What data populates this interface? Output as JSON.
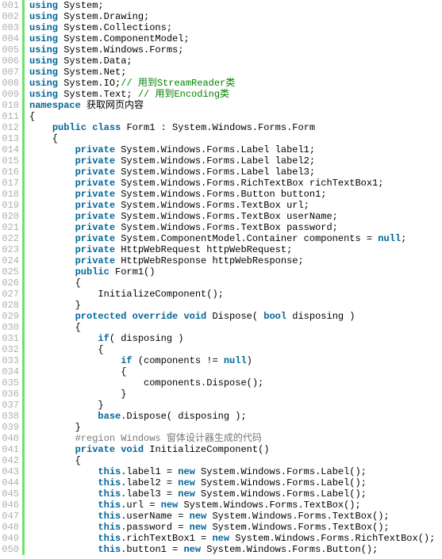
{
  "lines": [
    {
      "num": "001",
      "tokens": [
        {
          "c": "kw",
          "t": "using"
        },
        {
          "c": "pl",
          "t": " System;"
        }
      ]
    },
    {
      "num": "002",
      "tokens": [
        {
          "c": "kw",
          "t": "using"
        },
        {
          "c": "pl",
          "t": " System.Drawing;"
        }
      ]
    },
    {
      "num": "003",
      "tokens": [
        {
          "c": "kw",
          "t": "using"
        },
        {
          "c": "pl",
          "t": " System.Collections;"
        }
      ]
    },
    {
      "num": "004",
      "tokens": [
        {
          "c": "kw",
          "t": "using"
        },
        {
          "c": "pl",
          "t": " System.ComponentModel;"
        }
      ]
    },
    {
      "num": "005",
      "tokens": [
        {
          "c": "kw",
          "t": "using"
        },
        {
          "c": "pl",
          "t": " System.Windows.Forms;"
        }
      ]
    },
    {
      "num": "006",
      "tokens": [
        {
          "c": "kw",
          "t": "using"
        },
        {
          "c": "pl",
          "t": " System.Data;"
        }
      ]
    },
    {
      "num": "007",
      "tokens": [
        {
          "c": "kw",
          "t": "using"
        },
        {
          "c": "pl",
          "t": " System.Net;"
        }
      ]
    },
    {
      "num": "008",
      "tokens": [
        {
          "c": "kw",
          "t": "using"
        },
        {
          "c": "pl",
          "t": " System.IO;"
        },
        {
          "c": "cm",
          "t": "// 用到StreamReader类"
        }
      ]
    },
    {
      "num": "009",
      "tokens": [
        {
          "c": "kw",
          "t": "using"
        },
        {
          "c": "pl",
          "t": " System.Text; "
        },
        {
          "c": "cm",
          "t": "// 用到Encoding类"
        }
      ]
    },
    {
      "num": "010",
      "tokens": [
        {
          "c": "kw",
          "t": "namespace"
        },
        {
          "c": "pl",
          "t": " 获取网页内容"
        }
      ]
    },
    {
      "num": "011",
      "tokens": [
        {
          "c": "pl",
          "t": "{"
        }
      ]
    },
    {
      "num": "012",
      "tokens": [
        {
          "c": "pl",
          "t": "    "
        },
        {
          "c": "kw",
          "t": "public"
        },
        {
          "c": "pl",
          "t": " "
        },
        {
          "c": "kw",
          "t": "class"
        },
        {
          "c": "pl",
          "t": " Form1 : System.Windows.Forms.Form"
        }
      ]
    },
    {
      "num": "013",
      "tokens": [
        {
          "c": "pl",
          "t": "    {"
        }
      ]
    },
    {
      "num": "014",
      "tokens": [
        {
          "c": "pl",
          "t": "        "
        },
        {
          "c": "kw",
          "t": "private"
        },
        {
          "c": "pl",
          "t": " System.Windows.Forms.Label label1;"
        }
      ]
    },
    {
      "num": "015",
      "tokens": [
        {
          "c": "pl",
          "t": "        "
        },
        {
          "c": "kw",
          "t": "private"
        },
        {
          "c": "pl",
          "t": " System.Windows.Forms.Label label2;"
        }
      ]
    },
    {
      "num": "016",
      "tokens": [
        {
          "c": "pl",
          "t": "        "
        },
        {
          "c": "kw",
          "t": "private"
        },
        {
          "c": "pl",
          "t": " System.Windows.Forms.Label label3;"
        }
      ]
    },
    {
      "num": "017",
      "tokens": [
        {
          "c": "pl",
          "t": "        "
        },
        {
          "c": "kw",
          "t": "private"
        },
        {
          "c": "pl",
          "t": " System.Windows.Forms.RichTextBox richTextBox1;"
        }
      ]
    },
    {
      "num": "018",
      "tokens": [
        {
          "c": "pl",
          "t": "        "
        },
        {
          "c": "kw",
          "t": "private"
        },
        {
          "c": "pl",
          "t": " System.Windows.Forms.Button button1;"
        }
      ]
    },
    {
      "num": "019",
      "tokens": [
        {
          "c": "pl",
          "t": "        "
        },
        {
          "c": "kw",
          "t": "private"
        },
        {
          "c": "pl",
          "t": " System.Windows.Forms.TextBox url;"
        }
      ]
    },
    {
      "num": "020",
      "tokens": [
        {
          "c": "pl",
          "t": "        "
        },
        {
          "c": "kw",
          "t": "private"
        },
        {
          "c": "pl",
          "t": " System.Windows.Forms.TextBox userName;"
        }
      ]
    },
    {
      "num": "021",
      "tokens": [
        {
          "c": "pl",
          "t": "        "
        },
        {
          "c": "kw",
          "t": "private"
        },
        {
          "c": "pl",
          "t": " System.Windows.Forms.TextBox password;"
        }
      ]
    },
    {
      "num": "022",
      "tokens": [
        {
          "c": "pl",
          "t": "        "
        },
        {
          "c": "kw",
          "t": "private"
        },
        {
          "c": "pl",
          "t": " System.ComponentModel.Container components = "
        },
        {
          "c": "kw",
          "t": "null"
        },
        {
          "c": "pl",
          "t": ";"
        }
      ]
    },
    {
      "num": "023",
      "tokens": [
        {
          "c": "pl",
          "t": "        "
        },
        {
          "c": "kw",
          "t": "private"
        },
        {
          "c": "pl",
          "t": " HttpWebRequest httpWebRequest;"
        }
      ]
    },
    {
      "num": "024",
      "tokens": [
        {
          "c": "pl",
          "t": "        "
        },
        {
          "c": "kw",
          "t": "private"
        },
        {
          "c": "pl",
          "t": " HttpWebResponse httpWebResponse;"
        }
      ]
    },
    {
      "num": "025",
      "tokens": [
        {
          "c": "pl",
          "t": "        "
        },
        {
          "c": "kw",
          "t": "public"
        },
        {
          "c": "pl",
          "t": " Form1()"
        }
      ]
    },
    {
      "num": "026",
      "tokens": [
        {
          "c": "pl",
          "t": "        {"
        }
      ]
    },
    {
      "num": "027",
      "tokens": [
        {
          "c": "pl",
          "t": "            InitializeComponent();"
        }
      ]
    },
    {
      "num": "028",
      "tokens": [
        {
          "c": "pl",
          "t": "        }"
        }
      ]
    },
    {
      "num": "029",
      "tokens": [
        {
          "c": "pl",
          "t": "        "
        },
        {
          "c": "kw",
          "t": "protected"
        },
        {
          "c": "pl",
          "t": " "
        },
        {
          "c": "kw",
          "t": "override"
        },
        {
          "c": "pl",
          "t": " "
        },
        {
          "c": "kw",
          "t": "void"
        },
        {
          "c": "pl",
          "t": " Dispose( "
        },
        {
          "c": "kw",
          "t": "bool"
        },
        {
          "c": "pl",
          "t": " disposing )"
        }
      ]
    },
    {
      "num": "030",
      "tokens": [
        {
          "c": "pl",
          "t": "        {"
        }
      ]
    },
    {
      "num": "031",
      "tokens": [
        {
          "c": "pl",
          "t": "            "
        },
        {
          "c": "kw",
          "t": "if"
        },
        {
          "c": "pl",
          "t": "( disposing )"
        }
      ]
    },
    {
      "num": "032",
      "tokens": [
        {
          "c": "pl",
          "t": "            {"
        }
      ]
    },
    {
      "num": "033",
      "tokens": [
        {
          "c": "pl",
          "t": "                "
        },
        {
          "c": "kw",
          "t": "if"
        },
        {
          "c": "pl",
          "t": " (components != "
        },
        {
          "c": "kw",
          "t": "null"
        },
        {
          "c": "pl",
          "t": ")"
        }
      ]
    },
    {
      "num": "034",
      "tokens": [
        {
          "c": "pl",
          "t": "                {"
        }
      ]
    },
    {
      "num": "035",
      "tokens": [
        {
          "c": "pl",
          "t": "                    components.Dispose();"
        }
      ]
    },
    {
      "num": "036",
      "tokens": [
        {
          "c": "pl",
          "t": "                }"
        }
      ]
    },
    {
      "num": "037",
      "tokens": [
        {
          "c": "pl",
          "t": "            }"
        }
      ]
    },
    {
      "num": "038",
      "tokens": [
        {
          "c": "pl",
          "t": "            "
        },
        {
          "c": "kw",
          "t": "base"
        },
        {
          "c": "pl",
          "t": ".Dispose( disposing );"
        }
      ]
    },
    {
      "num": "039",
      "tokens": [
        {
          "c": "pl",
          "t": "        }"
        }
      ]
    },
    {
      "num": "040",
      "tokens": [
        {
          "c": "pl",
          "t": "        "
        },
        {
          "c": "rg",
          "t": "#region Windows 窗体设计器生成的代码"
        }
      ]
    },
    {
      "num": "041",
      "tokens": [
        {
          "c": "pl",
          "t": "        "
        },
        {
          "c": "kw",
          "t": "private"
        },
        {
          "c": "pl",
          "t": " "
        },
        {
          "c": "kw",
          "t": "void"
        },
        {
          "c": "pl",
          "t": " InitializeComponent()"
        }
      ]
    },
    {
      "num": "042",
      "tokens": [
        {
          "c": "pl",
          "t": "        {"
        }
      ]
    },
    {
      "num": "043",
      "tokens": [
        {
          "c": "pl",
          "t": "            "
        },
        {
          "c": "kw",
          "t": "this"
        },
        {
          "c": "pl",
          "t": ".label1 = "
        },
        {
          "c": "kw",
          "t": "new"
        },
        {
          "c": "pl",
          "t": " System.Windows.Forms.Label();"
        }
      ]
    },
    {
      "num": "044",
      "tokens": [
        {
          "c": "pl",
          "t": "            "
        },
        {
          "c": "kw",
          "t": "this"
        },
        {
          "c": "pl",
          "t": ".label2 = "
        },
        {
          "c": "kw",
          "t": "new"
        },
        {
          "c": "pl",
          "t": " System.Windows.Forms.Label();"
        }
      ]
    },
    {
      "num": "045",
      "tokens": [
        {
          "c": "pl",
          "t": "            "
        },
        {
          "c": "kw",
          "t": "this"
        },
        {
          "c": "pl",
          "t": ".label3 = "
        },
        {
          "c": "kw",
          "t": "new"
        },
        {
          "c": "pl",
          "t": " System.Windows.Forms.Label();"
        }
      ]
    },
    {
      "num": "046",
      "tokens": [
        {
          "c": "pl",
          "t": "            "
        },
        {
          "c": "kw",
          "t": "this"
        },
        {
          "c": "pl",
          "t": ".url = "
        },
        {
          "c": "kw",
          "t": "new"
        },
        {
          "c": "pl",
          "t": " System.Windows.Forms.TextBox();"
        }
      ]
    },
    {
      "num": "047",
      "tokens": [
        {
          "c": "pl",
          "t": "            "
        },
        {
          "c": "kw",
          "t": "this"
        },
        {
          "c": "pl",
          "t": ".userName = "
        },
        {
          "c": "kw",
          "t": "new"
        },
        {
          "c": "pl",
          "t": " System.Windows.Forms.TextBox();"
        }
      ]
    },
    {
      "num": "048",
      "tokens": [
        {
          "c": "pl",
          "t": "            "
        },
        {
          "c": "kw",
          "t": "this"
        },
        {
          "c": "pl",
          "t": ".password = "
        },
        {
          "c": "kw",
          "t": "new"
        },
        {
          "c": "pl",
          "t": " System.Windows.Forms.TextBox();"
        }
      ]
    },
    {
      "num": "049",
      "tokens": [
        {
          "c": "pl",
          "t": "            "
        },
        {
          "c": "kw",
          "t": "this"
        },
        {
          "c": "pl",
          "t": ".richTextBox1 = "
        },
        {
          "c": "kw",
          "t": "new"
        },
        {
          "c": "pl",
          "t": " System.Windows.Forms.RichTextBox();"
        }
      ]
    },
    {
      "num": "050",
      "tokens": [
        {
          "c": "pl",
          "t": "            "
        },
        {
          "c": "kw",
          "t": "this"
        },
        {
          "c": "pl",
          "t": ".button1 = "
        },
        {
          "c": "kw",
          "t": "new"
        },
        {
          "c": "pl",
          "t": " System.Windows.Forms.Button();"
        }
      ]
    }
  ]
}
